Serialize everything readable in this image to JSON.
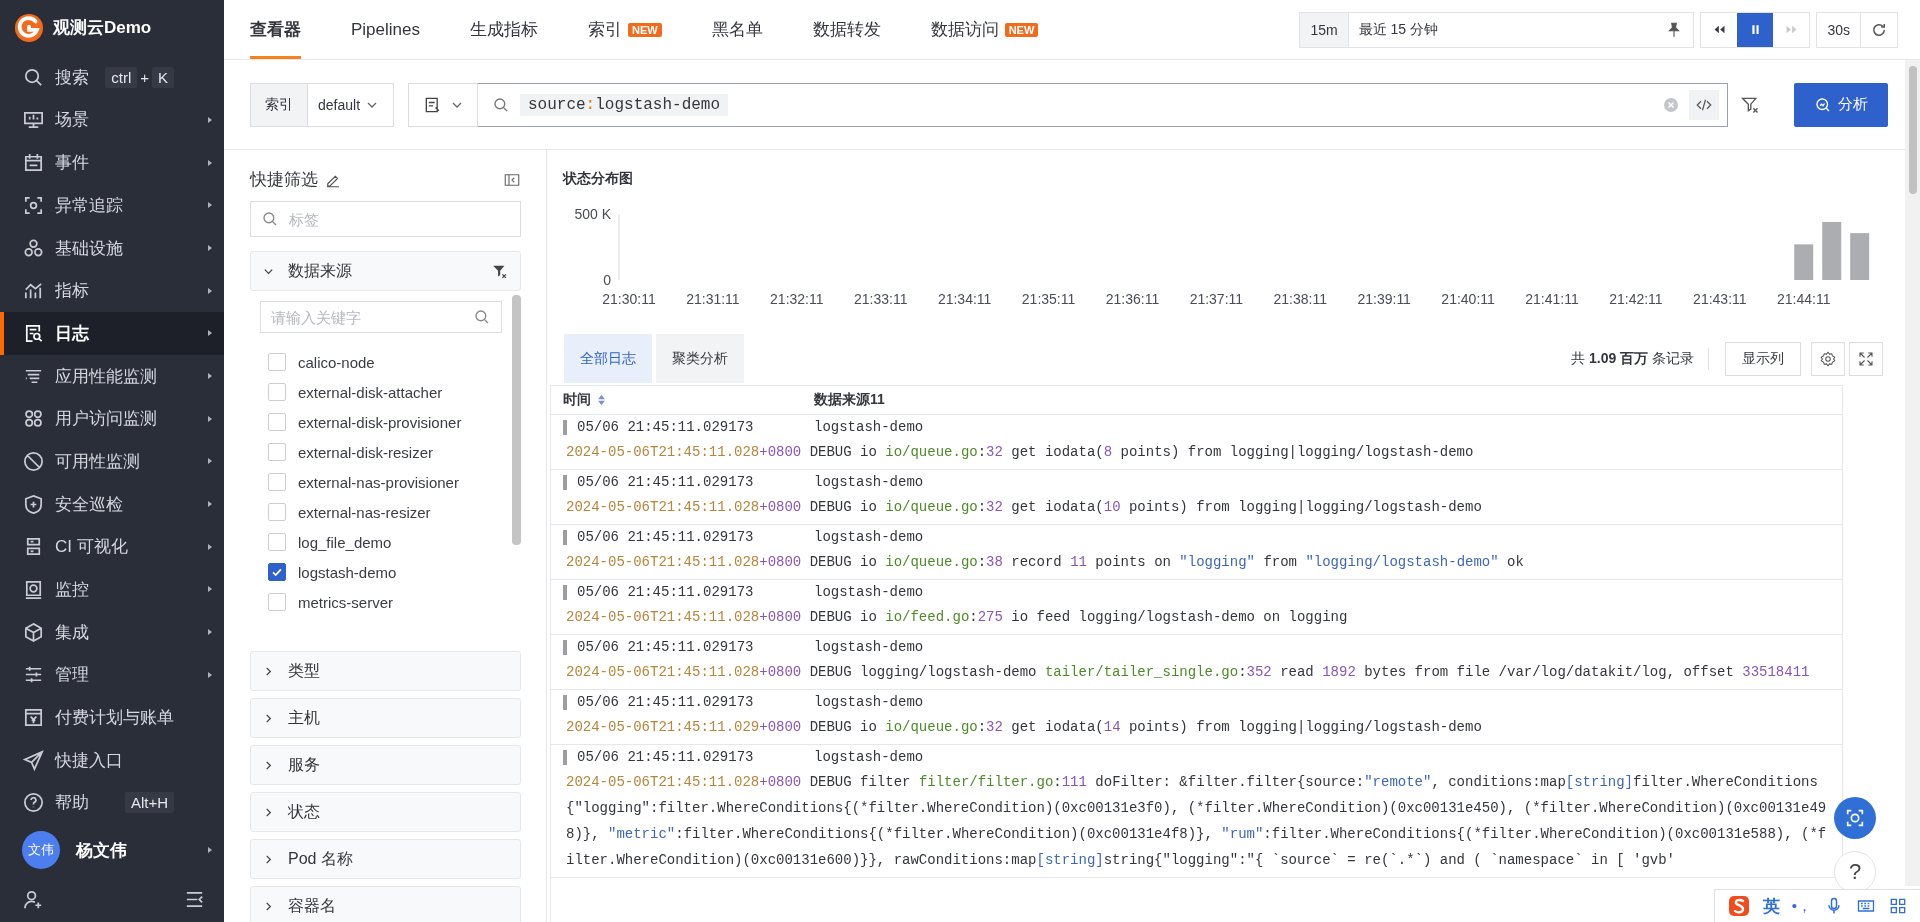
{
  "sidebar": {
    "brand": "观测云Demo",
    "items": [
      {
        "label": "搜索",
        "selected": false,
        "has_submenu": false,
        "shortcut": [
          {
            "kind": "key",
            "text": "ctrl"
          },
          {
            "kind": "plain",
            "text": "+"
          },
          {
            "kind": "key",
            "text": "K"
          }
        ]
      },
      {
        "label": "场景",
        "selected": false,
        "has_submenu": true
      },
      {
        "label": "事件",
        "selected": false,
        "has_submenu": true
      },
      {
        "label": "异常追踪",
        "selected": false,
        "has_submenu": true
      },
      {
        "label": "基础设施",
        "selected": false,
        "has_submenu": true
      },
      {
        "label": "指标",
        "selected": false,
        "has_submenu": true
      },
      {
        "label": "日志",
        "selected": true,
        "has_submenu": true
      },
      {
        "label": "应用性能监测",
        "selected": false,
        "has_submenu": true
      },
      {
        "label": "用户访问监测",
        "selected": false,
        "has_submenu": true
      },
      {
        "label": "可用性监测",
        "selected": false,
        "has_submenu": true
      },
      {
        "label": "安全巡检",
        "selected": false,
        "has_submenu": true
      },
      {
        "label": "CI 可视化",
        "selected": false,
        "has_submenu": true
      },
      {
        "label": "监控",
        "selected": false,
        "has_submenu": true
      },
      {
        "label": "集成",
        "selected": false,
        "has_submenu": true
      },
      {
        "label": "管理",
        "selected": false,
        "has_submenu": true
      },
      {
        "label": "付费计划与账单",
        "selected": false,
        "has_submenu": false
      },
      {
        "label": "快捷入口",
        "selected": false,
        "has_submenu": false
      },
      {
        "label": "帮助",
        "selected": false,
        "has_submenu": false,
        "shortcut": [
          {
            "kind": "key",
            "text": "Alt+H"
          }
        ]
      }
    ],
    "user": {
      "avatar": "文伟",
      "name": "杨文伟",
      "has_submenu": true
    }
  },
  "tabs": [
    {
      "label": "查看器",
      "selected": true
    },
    {
      "label": "Pipelines",
      "selected": false
    },
    {
      "label": "生成指标",
      "selected": false
    },
    {
      "label": "索引",
      "selected": false,
      "badge": "NEW"
    },
    {
      "label": "黑名单",
      "selected": false
    },
    {
      "label": "数据转发",
      "selected": false
    },
    {
      "label": "数据访问",
      "selected": false,
      "badge": "NEW"
    }
  ],
  "time_range": {
    "short": "15m",
    "label": "最近 15 分钟"
  },
  "playback": [
    {
      "kind": "rewind",
      "selected": false,
      "disabled": false
    },
    {
      "kind": "pause",
      "selected": true,
      "disabled": false
    },
    {
      "kind": "forward",
      "selected": false,
      "disabled": true
    }
  ],
  "refresh": {
    "interval": "30s"
  },
  "query_bar": {
    "index_label": "索引",
    "index_value": "default",
    "query": [
      {
        "kind": "key",
        "text": "source"
      },
      {
        "kind": "sep",
        "text": ":"
      },
      {
        "kind": "value",
        "text": "logstash-demo"
      }
    ],
    "analyze_button": "分析"
  },
  "filter_panel": {
    "title": "快捷筛选",
    "search": {
      "placeholder": "标签"
    },
    "groups": [
      {
        "label": "数据来源",
        "expanded": true,
        "search": {
          "placeholder": "请输入关键字"
        },
        "options": [
          {
            "label": "calico-node",
            "checked": false
          },
          {
            "label": "external-disk-attacher",
            "checked": false
          },
          {
            "label": "external-disk-provisioner",
            "checked": false
          },
          {
            "label": "external-disk-resizer",
            "checked": false
          },
          {
            "label": "external-nas-provisioner",
            "checked": false
          },
          {
            "label": "external-nas-resizer",
            "checked": false
          },
          {
            "label": "log_file_demo",
            "checked": false
          },
          {
            "label": "logstash-demo",
            "checked": true
          },
          {
            "label": "metrics-server",
            "checked": false
          }
        ]
      },
      {
        "label": "类型",
        "expanded": false
      },
      {
        "label": "主机",
        "expanded": false
      },
      {
        "label": "服务",
        "expanded": false
      },
      {
        "label": "状态",
        "expanded": false
      },
      {
        "label": "Pod 名称",
        "expanded": false
      },
      {
        "label": "容器名",
        "expanded": false
      }
    ]
  },
  "main": {
    "chart": {
      "chart_data": {
        "type": "bar",
        "title": "状态分布图",
        "categories": [
          "21:30:11",
          null,
          null,
          "21:31:11",
          null,
          null,
          "21:32:11",
          null,
          null,
          "21:33:11",
          null,
          null,
          "21:34:11",
          null,
          null,
          "21:35:11",
          null,
          null,
          "21:36:11",
          null,
          null,
          "21:37:11",
          null,
          null,
          "21:38:11",
          null,
          null,
          "21:39:11",
          null,
          null,
          "21:40:11",
          null,
          null,
          "21:41:11",
          null,
          null,
          "21:42:11",
          null,
          null,
          "21:43:11",
          null,
          null,
          "21:44:11",
          null,
          null
        ],
        "values": [
          0,
          0,
          0,
          0,
          0,
          0,
          0,
          0,
          0,
          0,
          0,
          0,
          0,
          0,
          0,
          0,
          0,
          0,
          0,
          0,
          0,
          0,
          0,
          0,
          0,
          0,
          0,
          0,
          0,
          0,
          0,
          0,
          0,
          0,
          0,
          0,
          0,
          0,
          0,
          0,
          0,
          0,
          270000,
          440000,
          355000
        ],
        "ylim": [
          0,
          500000
        ],
        "yticks": [
          {
            "value": 0,
            "label": "0"
          },
          {
            "value": 500000,
            "label": "500 K"
          }
        ]
      }
    },
    "tabs": [
      {
        "label": "全部日志",
        "selected": true
      },
      {
        "label": "聚类分析",
        "selected": false
      }
    ],
    "record_count": "共 **1.09 百万** 条记录",
    "columns_button": "显示列",
    "columns": [
      {
        "label": "时间",
        "sortable": true
      },
      {
        "label": "数据来源11",
        "sortable": false
      }
    ],
    "rows": [
      {
        "time": "05/06 21:45:11.029173",
        "source": "logstash-demo",
        "message": [
          {
            "kind": "ts",
            "text": "2024-05-06T21:45:11.028"
          },
          {
            "kind": "tz",
            "text": "+0800"
          },
          {
            "kind": "plain",
            "text": " DEBUG io "
          },
          {
            "kind": "file",
            "text": "io/queue.go"
          },
          {
            "kind": "plain",
            "text": ":"
          },
          {
            "kind": "num",
            "text": "32"
          },
          {
            "kind": "plain",
            "text": " get iodata("
          },
          {
            "kind": "num",
            "text": "8"
          },
          {
            "kind": "plain",
            "text": " points) from logging|logging/logstash-demo"
          }
        ]
      },
      {
        "time": "05/06 21:45:11.029173",
        "source": "logstash-demo",
        "message": [
          {
            "kind": "ts",
            "text": "2024-05-06T21:45:11.028"
          },
          {
            "kind": "tz",
            "text": "+0800"
          },
          {
            "kind": "plain",
            "text": " DEBUG io "
          },
          {
            "kind": "file",
            "text": "io/queue.go"
          },
          {
            "kind": "plain",
            "text": ":"
          },
          {
            "kind": "num",
            "text": "32"
          },
          {
            "kind": "plain",
            "text": " get iodata("
          },
          {
            "kind": "num",
            "text": "10"
          },
          {
            "kind": "plain",
            "text": " points) from logging|logging/logstash-demo"
          }
        ]
      },
      {
        "time": "05/06 21:45:11.029173",
        "source": "logstash-demo",
        "message": [
          {
            "kind": "ts",
            "text": "2024-05-06T21:45:11.028"
          },
          {
            "kind": "tz",
            "text": "+0800"
          },
          {
            "kind": "plain",
            "text": " DEBUG io "
          },
          {
            "kind": "file",
            "text": "io/queue.go"
          },
          {
            "kind": "plain",
            "text": ":"
          },
          {
            "kind": "num",
            "text": "38"
          },
          {
            "kind": "plain",
            "text": " record "
          },
          {
            "kind": "num",
            "text": "11"
          },
          {
            "kind": "plain",
            "text": " points on "
          },
          {
            "kind": "str",
            "text": "\"logging\""
          },
          {
            "kind": "plain",
            "text": " from "
          },
          {
            "kind": "str",
            "text": "\"logging/logstash-demo\""
          },
          {
            "kind": "plain",
            "text": " ok"
          }
        ]
      },
      {
        "time": "05/06 21:45:11.029173",
        "source": "logstash-demo",
        "message": [
          {
            "kind": "ts",
            "text": "2024-05-06T21:45:11.028"
          },
          {
            "kind": "tz",
            "text": "+0800"
          },
          {
            "kind": "plain",
            "text": " DEBUG io "
          },
          {
            "kind": "file",
            "text": "io/feed.go"
          },
          {
            "kind": "plain",
            "text": ":"
          },
          {
            "kind": "num",
            "text": "275"
          },
          {
            "kind": "plain",
            "text": " io feed logging/logstash-demo on logging"
          }
        ]
      },
      {
        "time": "05/06 21:45:11.029173",
        "source": "logstash-demo",
        "message": [
          {
            "kind": "ts",
            "text": "2024-05-06T21:45:11.028"
          },
          {
            "kind": "tz",
            "text": "+0800"
          },
          {
            "kind": "plain",
            "text": " DEBUG logging/logstash-demo "
          },
          {
            "kind": "file",
            "text": "tailer/tailer_single.go"
          },
          {
            "kind": "plain",
            "text": ":"
          },
          {
            "kind": "num",
            "text": "352"
          },
          {
            "kind": "plain",
            "text": " read "
          },
          {
            "kind": "num",
            "text": "1892"
          },
          {
            "kind": "plain",
            "text": " bytes from file /var/log/datakit/log, offset "
          },
          {
            "kind": "num",
            "text": "33518411"
          }
        ]
      },
      {
        "time": "05/06 21:45:11.029173",
        "source": "logstash-demo",
        "message": [
          {
            "kind": "ts",
            "text": "2024-05-06T21:45:11.029"
          },
          {
            "kind": "tz",
            "text": "+0800"
          },
          {
            "kind": "plain",
            "text": " DEBUG io "
          },
          {
            "kind": "file",
            "text": "io/queue.go"
          },
          {
            "kind": "plain",
            "text": ":"
          },
          {
            "kind": "num",
            "text": "32"
          },
          {
            "kind": "plain",
            "text": " get iodata("
          },
          {
            "kind": "num",
            "text": "14"
          },
          {
            "kind": "plain",
            "text": " points) from logging|logging/logstash-demo"
          }
        ]
      },
      {
        "time": "05/06 21:45:11.029173",
        "source": "logstash-demo",
        "message": [
          {
            "kind": "ts",
            "text": "2024-05-06T21:45:11.028"
          },
          {
            "kind": "tz",
            "text": "+0800"
          },
          {
            "kind": "plain",
            "text": " DEBUG filter "
          },
          {
            "kind": "file",
            "text": "filter/filter.go"
          },
          {
            "kind": "plain",
            "text": ":"
          },
          {
            "kind": "num",
            "text": "111"
          },
          {
            "kind": "plain",
            "text": " doFilter: &filter.filter{source:"
          },
          {
            "kind": "str",
            "text": "\"remote\""
          },
          {
            "kind": "plain",
            "text": ", conditions:map"
          },
          {
            "kind": "type",
            "text": "[string]"
          },
          {
            "kind": "plain",
            "text": "filter.WhereConditions{\"logging\":filter.WhereConditions{(*filter.WhereCondition)(0xc00131e3f0), (*filter.WhereCondition)(0xc00131e450), (*filter.WhereCondition)(0xc00131e498)}, "
          },
          {
            "kind": "str",
            "text": "\"metric\""
          },
          {
            "kind": "plain",
            "text": ":filter.WhereConditions{(*filter.WhereCondition)(0xc00131e4f8)}, "
          },
          {
            "kind": "str",
            "text": "\"rum\""
          },
          {
            "kind": "plain",
            "text": ":filter.WhereConditions{(*filter.WhereCondition)(0xc00131e588), (*filter.WhereCondition)(0xc00131e600)}}, rawConditions:map"
          },
          {
            "kind": "type",
            "text": "[string]"
          },
          {
            "kind": "plain",
            "text": "string{\"logging\":\"{ `source` = re(`.*`) and ( `namespace` in [ 'gvb'"
          }
        ]
      }
    ],
    "help_button": "?"
  },
  "ime_bar": {
    "mode": "英",
    "punctuation": "•，"
  }
}
